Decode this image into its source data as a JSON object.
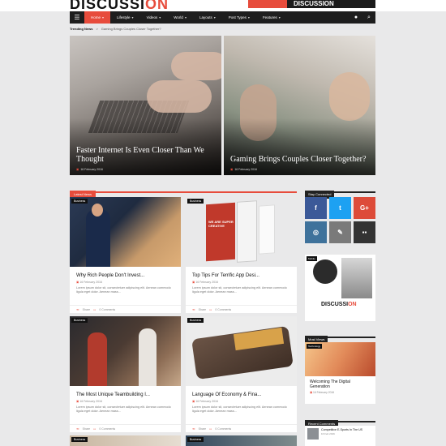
{
  "brand": {
    "logo_main": "DISCUSSI",
    "logo_accent": "ON"
  },
  "top_banner": {
    "text": "DISCUSSION"
  },
  "nav": {
    "items": [
      {
        "label": "Home",
        "active": true
      },
      {
        "label": "Lifestyle"
      },
      {
        "label": "Videos"
      },
      {
        "label": "World"
      },
      {
        "label": "Layouts"
      },
      {
        "label": "Post Types"
      },
      {
        "label": "Features"
      }
    ]
  },
  "trending": {
    "label": "Trending News",
    "arrow": ">",
    "text": "Gaming Brings Couples Closer Together?"
  },
  "hero": [
    {
      "title": "Faster Internet Is Even Closer Than We Thought",
      "date": "16 February 2016"
    },
    {
      "title": "Gaming Brings Couples Closer Together?",
      "date": "16 February 2016"
    }
  ],
  "latest": {
    "heading": "Latest News",
    "cards": [
      {
        "tag": "Business",
        "title": "Why Rich People Don't Invest...",
        "date": "16 February 2016",
        "excerpt": "Lorem ipsum dolor sit, consectetuer adipiscing elit. Aenean commodo ligula eget dolor. Aenean mass...",
        "share": "Share",
        "comments": "0 Comments"
      },
      {
        "tag": "Business",
        "title": "Top Tips For Terrific App Desi...",
        "date": "16 February 2016",
        "excerpt": "Lorem ipsum dolor sit, consectetuer adipiscing elit. Aenean commodo ligula eget dolor. Aenean mass...",
        "share": "Share",
        "comments": "0 Comments",
        "poster_text": "WE ARE SUPER CREATIVE"
      },
      {
        "tag": "Business",
        "title": "The Most Unique Teambuilding I...",
        "date": "16 February 2016",
        "excerpt": "Lorem ipsum dolor sit, consectetuer adipiscing elit. Aenean commodo ligula eget dolor. Aenean mass...",
        "share": "Share",
        "comments": "0 Comments"
      },
      {
        "tag": "Business",
        "title": "Language Of Economy & Fina...",
        "date": "16 February 2016",
        "excerpt": "Lorem ipsum dolor sit, consectetuer adipiscing elit. Aenean commodo ligula eget dolor. Aenean mass...",
        "share": "Share",
        "comments": "0 Comments"
      },
      {
        "tag": "Business"
      },
      {
        "tag": "Business"
      }
    ]
  },
  "sidebar": {
    "stay_connected": "Stay Connected",
    "social": [
      {
        "icon": "f",
        "name": "facebook-icon",
        "color": "#3b5998"
      },
      {
        "icon": "t",
        "name": "twitter-icon",
        "color": "#1da1f2"
      },
      {
        "icon": "G+",
        "name": "google-plus-icon",
        "color": "#dd4b39"
      },
      {
        "icon": "◎",
        "name": "instagram-icon",
        "color": "#3f729b"
      },
      {
        "icon": "✎",
        "name": "edit-icon",
        "color": "#7a7a7a"
      },
      {
        "icon": "▪▪",
        "name": "grid-icon",
        "color": "#333333"
      }
    ],
    "ad_tag": "Mobile",
    "ad_logo_main": "DISCUSSI",
    "ad_logo_accent": "ON",
    "most_views": "Most Views",
    "mv_tag": "Technology",
    "mv_title": "Welcoming The Digital Generation",
    "mv_date": "16 February 2016",
    "recent_comments": "Recent Comments",
    "rc_title": "Competitive E-Sports In The US",
    "rc_meta": "16 Feb 2016"
  },
  "colors": {
    "accent": "#e74c3c",
    "nav_bg": "#1e1e1e",
    "page_bg": "#e9e9ea"
  }
}
